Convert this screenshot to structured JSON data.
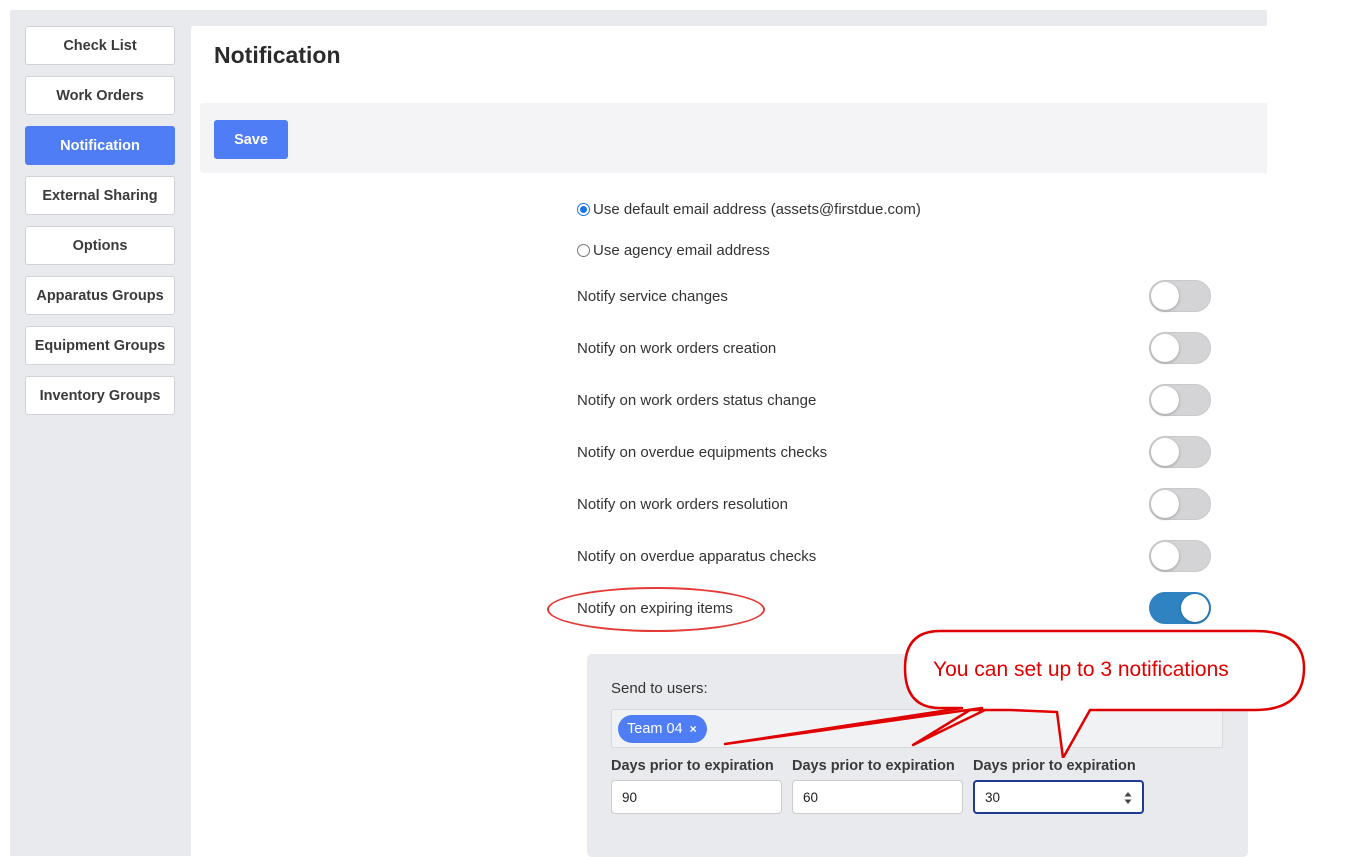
{
  "sidebar": {
    "items": [
      {
        "label": "Check List"
      },
      {
        "label": "Work Orders"
      },
      {
        "label": "Notification"
      },
      {
        "label": "External Sharing"
      },
      {
        "label": "Options"
      },
      {
        "label": "Apparatus Groups"
      },
      {
        "label": "Equipment Groups"
      },
      {
        "label": "Inventory Groups"
      }
    ],
    "active_item": "Notification"
  },
  "page": {
    "title": "Notification"
  },
  "toolbar": {
    "save_label": "Save"
  },
  "email": {
    "default_label": "Use default email address (assets@firstdue.com)",
    "agency_label": "Use agency email address",
    "selected": "default"
  },
  "notifications": [
    {
      "label": "Notify service changes",
      "enabled": false
    },
    {
      "label": "Notify on work orders creation",
      "enabled": false
    },
    {
      "label": "Notify on work orders status change",
      "enabled": false
    },
    {
      "label": "Notify on overdue equipments checks",
      "enabled": false
    },
    {
      "label": "Notify on work orders resolution",
      "enabled": false
    },
    {
      "label": "Notify on overdue apparatus checks",
      "enabled": false
    },
    {
      "label": "Notify on expiring items",
      "enabled": true
    }
  ],
  "expiring_panel": {
    "send_to_label": "Send to users:",
    "tags": [
      {
        "label": "Team 04",
        "remove": "×"
      }
    ],
    "fields": [
      {
        "label": "Days prior to expiration",
        "value": "90"
      },
      {
        "label": "Days prior to expiration",
        "value": "60"
      },
      {
        "label": "Days prior to expiration",
        "value": "30"
      }
    ]
  },
  "annotation": {
    "callout_text": "You can set up to 3 notifications",
    "color": "#e00000"
  },
  "colors": {
    "accent": "#4f7df6",
    "toggle_on": "#2e83c0",
    "background": "#e9eaee"
  }
}
